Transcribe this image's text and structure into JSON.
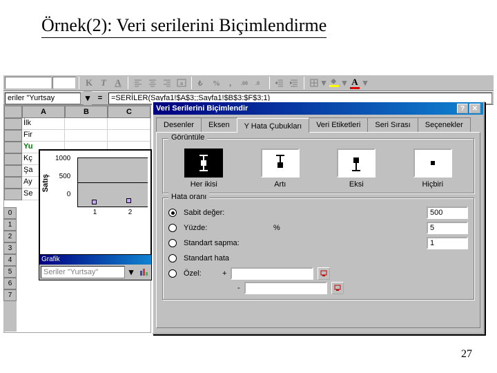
{
  "slide": {
    "title": "Örnek(2): Veri serilerini Biçimlendirme",
    "page_number": "27"
  },
  "toolbar": {
    "btns": {
      "bold": "K",
      "italic": "T",
      "underline": "A"
    }
  },
  "formula": {
    "name_box": "eriler \"Yurtsay",
    "eq": "=",
    "value": "=SERİLER(Sayfa1!$A$3;;Sayfa1!$B$3:$F$3;1)"
  },
  "sheet": {
    "columns": [
      "A",
      "B",
      "C"
    ],
    "rows": [
      "",
      "İlk",
      "Fir",
      "Yu",
      "Kç",
      "Şa",
      "Ay",
      "Se"
    ]
  },
  "row_strip": [
    "0",
    "1",
    "2",
    "3",
    "4",
    "5",
    "6",
    "7"
  ],
  "chart_data": {
    "type": "scatter",
    "ylabel": "Satış",
    "ytick": [
      "1000",
      "500",
      "0"
    ],
    "xlabel": [
      "1",
      "2"
    ],
    "series": [
      {
        "name": "Yurtsay",
        "x": [
          1,
          2
        ],
        "y": [
          80,
          120
        ]
      }
    ],
    "ylim": [
      0,
      1000
    ]
  },
  "grafik": {
    "title": "Grafik",
    "selector": "Seriler \"Yurtsay\""
  },
  "dialog": {
    "title": "Veri Serilerini Biçimlendir",
    "tabs": [
      "Desenler",
      "Eksen",
      "Y Hata Çubukları",
      "Veri Etiketleri",
      "Seri Sırası",
      "Seçenekler"
    ],
    "active_tab": 2,
    "display": {
      "group": "Görüntüle",
      "items": [
        "Her ikisi",
        "Artı",
        "Eksi",
        "Hiçbiri"
      ],
      "selected": 0
    },
    "error": {
      "group": "Hata oranı",
      "options": [
        "Sabit değer:",
        "Yüzde:",
        "Standart sapma:",
        "Standart hata",
        "Özel:"
      ],
      "selected": 0,
      "values": {
        "sabit": "500",
        "yuzde": "5",
        "sapma": "1",
        "ozel_plus": "",
        "ozel_minus": ""
      },
      "plus": "+",
      "minus": "-",
      "pct": "%"
    }
  }
}
